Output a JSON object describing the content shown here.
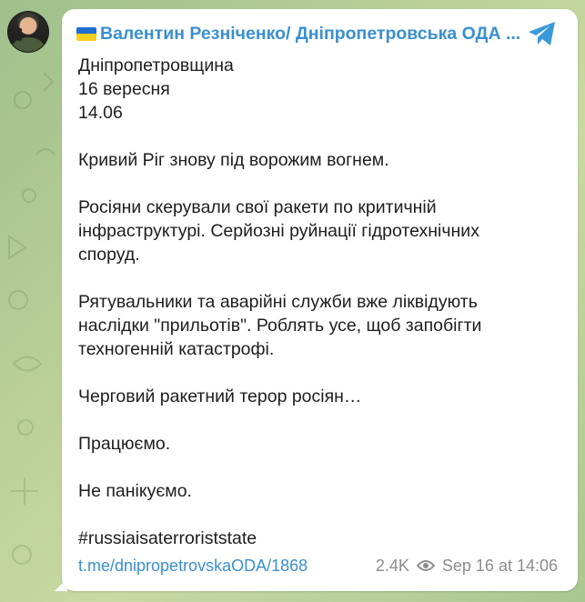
{
  "channel": {
    "name": "Валентин Резніченко/ Дніпропетровська ОДА ...",
    "flag_colors": [
      "#1f6fd1",
      "#f7cf1c"
    ],
    "share_icon": "telegram-plane-icon"
  },
  "message": {
    "lines": [
      "Дніпропетровщина",
      "16 вересня",
      "14.06",
      "",
      "Кривий Ріг знову під ворожим вогнем.",
      "",
      "Росіяни скерували свої ракети по критичній",
      "інфраструктурі. Серйозні руйнації гідротехнічних",
      "споруд.",
      "",
      "Рятувальники та аварійні служби вже ліквідують",
      "наслідки \"прильотів\". Роблять усе, щоб запобігти",
      "техногенній катастрофі.",
      "",
      "Черговий ракетний терор росіян…",
      "",
      "Працюємо.",
      "",
      "Не панікуємо.",
      "",
      "#russiaisaterroriststate"
    ],
    "link": "t.me/dnipropetrovskaODA/1868",
    "views": "2.4K",
    "timestamp": "Sep 16 at 14:06"
  },
  "colors": {
    "accent": "#3a8fd0",
    "text": "#1d1d1d",
    "meta": "#8c8c8c"
  }
}
